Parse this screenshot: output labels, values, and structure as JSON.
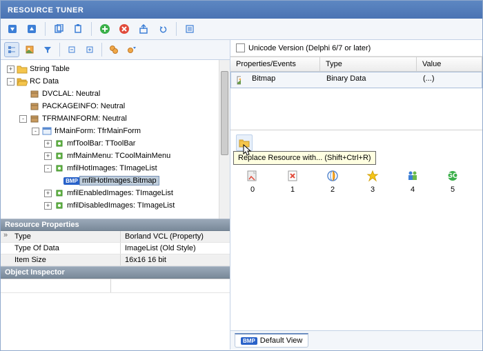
{
  "title": "RESOURCE TUNER",
  "unicode_label": "Unicode Version (Delphi 6/7 or later)",
  "prop_table": {
    "headers": {
      "prop": "Properties/Events",
      "type": "Type",
      "value": "Value"
    },
    "row": {
      "prop": "Bitmap",
      "type": "Binary Data",
      "value": "(...)"
    }
  },
  "tooltip": "Replace Resource with... (Shift+Ctrl+R)",
  "tree": [
    {
      "indent": 0,
      "toggle": "+",
      "icon": "folder",
      "label": "String Table"
    },
    {
      "indent": 0,
      "toggle": "-",
      "icon": "folder-open",
      "label": "RC Data"
    },
    {
      "indent": 1,
      "toggle": "",
      "icon": "box-brown",
      "label": "DVCLAL: Neutral"
    },
    {
      "indent": 1,
      "toggle": "",
      "icon": "box-brown",
      "label": "PACKAGEINFO: Neutral"
    },
    {
      "indent": 1,
      "toggle": "-",
      "icon": "box-brown",
      "label": "TFRMAINFORM: Neutral"
    },
    {
      "indent": 2,
      "toggle": "-",
      "icon": "form",
      "label": "frMainForm: TfrMainForm"
    },
    {
      "indent": 3,
      "toggle": "+",
      "icon": "comp-green",
      "label": "mfToolBar: TToolBar"
    },
    {
      "indent": 3,
      "toggle": "+",
      "icon": "comp-green",
      "label": "mfMainMenu: TCoolMainMenu"
    },
    {
      "indent": 3,
      "toggle": "-",
      "icon": "comp-green",
      "label": "mfilHotImages: TImageList"
    },
    {
      "indent": 4,
      "toggle": "",
      "icon": "bmp",
      "label": "mfilHotImages.Bitmap",
      "selected": true
    },
    {
      "indent": 3,
      "toggle": "+",
      "icon": "comp-green",
      "label": "mfilEnabledImages: TImageList"
    },
    {
      "indent": 3,
      "toggle": "+",
      "icon": "comp-green",
      "label": "mfilDisabledImages: TImageList"
    }
  ],
  "resource_props_title": "Resource Properties",
  "resource_props": [
    {
      "name": "Type",
      "value": "Borland VCL (Property)",
      "arrow": true
    },
    {
      "name": "Type Of Data",
      "value": "ImageList (Old Style)"
    },
    {
      "name": "Item Size",
      "value": "16x16 16 bit"
    }
  ],
  "inspector_title": "Object Inspector",
  "icon_labels": [
    "0",
    "1",
    "2",
    "3",
    "4",
    "5"
  ],
  "tab_label": "Default View"
}
